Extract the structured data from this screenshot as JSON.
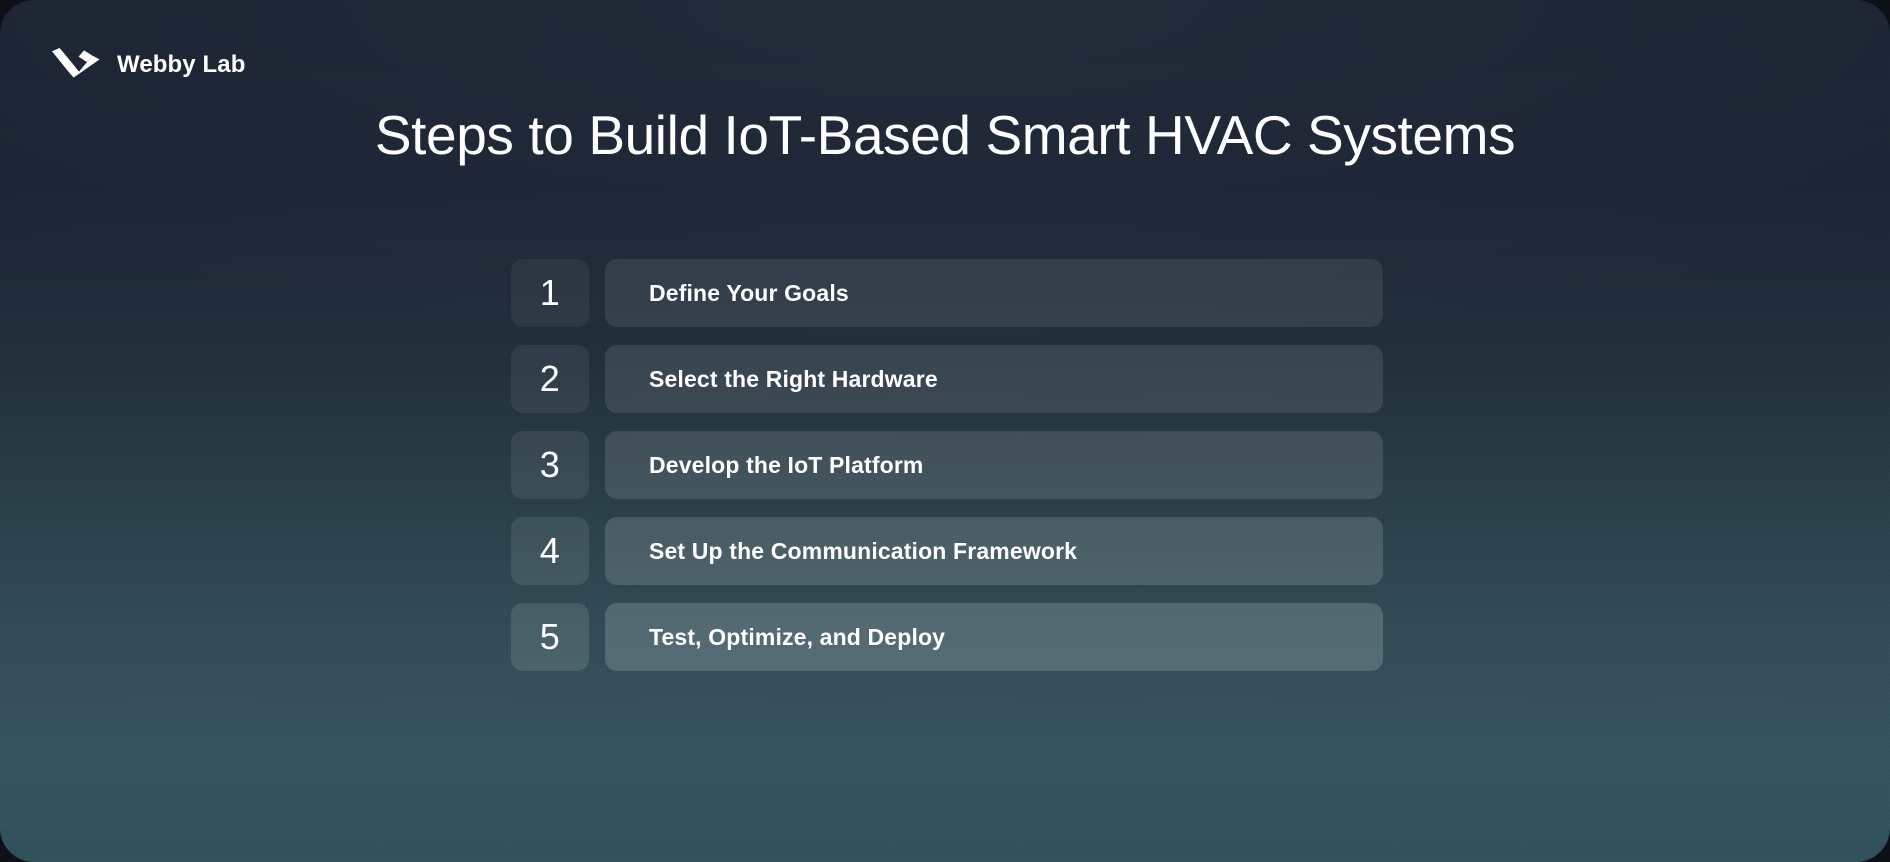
{
  "brand": {
    "name": "Webby Lab",
    "logo_icon": "webbylab-chevron-logo",
    "logo_color": "#ffffff"
  },
  "title": "Steps to Build IoT-Based Smart HVAC Systems",
  "theme": {
    "background_top": "#1b2332",
    "background_bottom": "#315059",
    "text_color": "#ffffff",
    "card_radius_px": 34
  },
  "steps": [
    {
      "number": "1",
      "label": "Define Your Goals",
      "chip_fill": "rgba(255,255,255,0.055)",
      "pill_fill": "rgba(255,255,255,0.085)"
    },
    {
      "number": "2",
      "label": "Select the Right Hardware",
      "chip_fill": "rgba(255,255,255,0.065)",
      "pill_fill": "rgba(255,255,255,0.100)"
    },
    {
      "number": "3",
      "label": "Develop the IoT Platform",
      "chip_fill": "rgba(255,255,255,0.080)",
      "pill_fill": "rgba(255,255,255,0.120)"
    },
    {
      "number": "4",
      "label": "Set Up the Communication Framework",
      "chip_fill": "rgba(255,255,255,0.095)",
      "pill_fill": "rgba(255,255,255,0.145)"
    },
    {
      "number": "5",
      "label": "Test, Optimize, and Deploy",
      "chip_fill": "rgba(255,255,255,0.115)",
      "pill_fill": "rgba(255,255,255,0.170)"
    }
  ]
}
